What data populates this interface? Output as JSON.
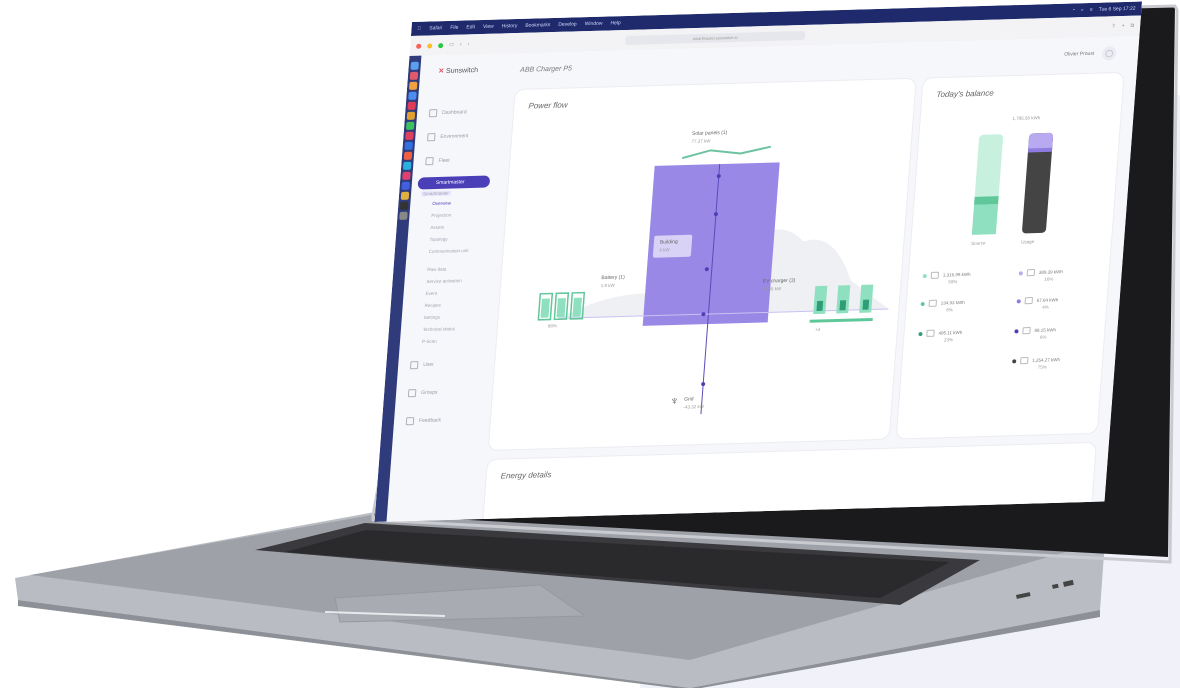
{
  "colors": {
    "purple": "#8f7ce0",
    "teal": "#8fe0c0",
    "brand": "#4b3fb8",
    "dark": "#444",
    "lavender": "#b8a9f0"
  },
  "menubar": {
    "apple": "",
    "items": [
      "Safari",
      "File",
      "Edit",
      "View",
      "History",
      "Bookmarks",
      "Develop",
      "Window",
      "Help"
    ],
    "clock": "Tue 6 Sep 17:22"
  },
  "browser": {
    "url": "smartmaster.sunswitch.io"
  },
  "app": {
    "logo": "Sunswitch",
    "page_title": "ABB Charger P5",
    "user_name": "Olivier Proust"
  },
  "sidebar": {
    "items": [
      {
        "label": "Dashboard",
        "icon": "dashboard-icon"
      },
      {
        "label": "Environment",
        "icon": "environment-icon"
      },
      {
        "label": "Fleet",
        "icon": "fleet-icon"
      }
    ],
    "active": {
      "label": "Smartmaster",
      "tooltip": "Smartmaster"
    },
    "sub_items": [
      "Overview",
      "Projection",
      "Assets",
      "Topology",
      "Communication unit",
      "Raw data",
      "Service activation",
      "Event",
      "Recipes",
      "Settings",
      "Technical status",
      "P-Scan"
    ],
    "bottom_items": [
      "User",
      "Groups",
      "Feedback"
    ]
  },
  "power_flow": {
    "title": "Power flow",
    "solar_label": "Solar panels (1)",
    "solar_value": "77.37 kW",
    "building_label": "Building",
    "building_value": "8 kW",
    "battery_label": "Battery (1)",
    "battery_value": "1.8 kW",
    "battery_soc": "88%",
    "ev_label": "EV charger (3)",
    "ev_value": "32.45 kW",
    "ev_more": "+3",
    "grid_label": "Grid",
    "grid_value": "-43.32 kW"
  },
  "balance": {
    "title": "Today's balance",
    "total": "1,785.56 kWh",
    "source_label": "Source",
    "usage_label": "Usage",
    "source_legend": [
      {
        "value": "1,316.99 kWh",
        "pct": "59%",
        "color": "#8fe0c0",
        "icon": "solar-icon"
      },
      {
        "value": "134.93 kWh",
        "pct": "8%",
        "color": "#5fc79a",
        "icon": "battery-icon"
      },
      {
        "value": "405.11 kWh",
        "pct": "23%",
        "color": "#2f9e76",
        "icon": "grid-icon"
      }
    ],
    "usage_legend": [
      {
        "value": "389.39 kWh",
        "pct": "16%",
        "color": "#b8a9f0",
        "icon": "building-icon"
      },
      {
        "value": "67.64 kWh",
        "pct": "4%",
        "color": "#8f7ce0",
        "icon": "car-icon"
      },
      {
        "value": "88.15 kWh",
        "pct": "6%",
        "color": "#4b3fb8",
        "icon": "battery-icon"
      },
      {
        "value": "1,254.27 kWh",
        "pct": "75%",
        "color": "#444444",
        "icon": "grid-export-icon"
      }
    ]
  },
  "energy_details": {
    "title": "Energy details"
  }
}
